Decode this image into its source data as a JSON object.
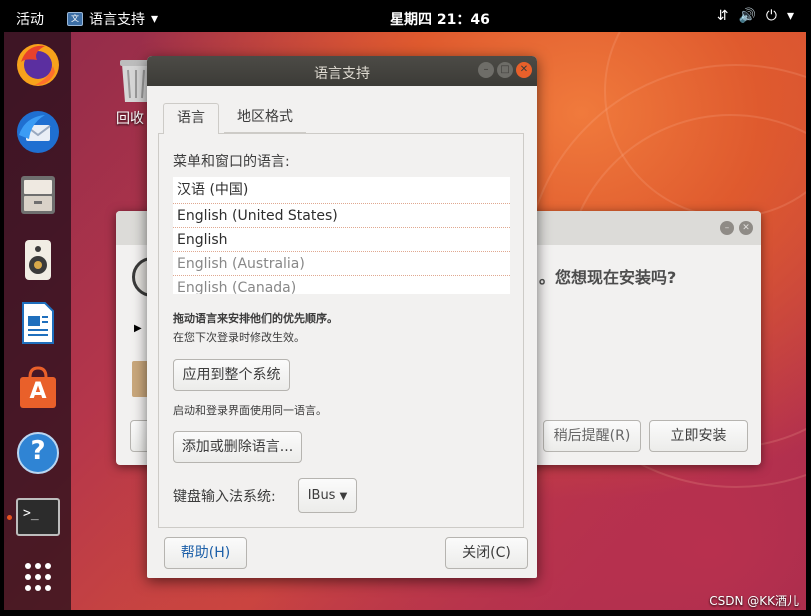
{
  "topbar": {
    "activities": "活动",
    "app_menu": "语言支持",
    "app_menu_arrow": "▾",
    "clock": "星期四 21：46",
    "tray_network": "⇵",
    "tray_volume": "🔊",
    "tray_power": "⏻",
    "tray_arrow": "▾"
  },
  "dock": {
    "items": [
      "firefox-icon",
      "thunderbird-icon",
      "files-icon",
      "rhythmbox-icon",
      "writer-icon",
      "software-icon",
      "help-icon",
      "terminal-icon"
    ],
    "help_glyph": "?",
    "software_glyph": "A",
    "terminal_glyph": ">_"
  },
  "desktop": {
    "trash_label": "回收"
  },
  "bg_dialog": {
    "question": "。您想现在安装吗?",
    "remind_later": "稍后提醒(R)",
    "install_now": "立即安装"
  },
  "dialog": {
    "title": "语言支持",
    "tabs": [
      "语言",
      "地区格式"
    ],
    "menu_lang_label": "菜单和窗口的语言:",
    "languages": [
      "汉语 (中国)",
      "English (United States)",
      "English",
      "English (Australia)",
      "English (Canada)"
    ],
    "drag_hint": "拖动语言来安排他们的优先顺序。",
    "next_login_hint": "在您下次登录时修改生效。",
    "apply_system_button": "应用到整个系统",
    "login_screen_hint": "启动和登录界面使用同一语言。",
    "add_remove_button": "添加或删除语言...",
    "input_method_label": "键盘输入法系统:",
    "input_method_value": "IBus",
    "help_button": "帮助(H)",
    "close_button": "关闭(C)"
  },
  "watermark": "CSDN @KK酒儿",
  "colors": {
    "accent": "#e95420",
    "titlebar": "#3c3b37",
    "close": "#e9602a",
    "dialog_bg": "#f2f1f0"
  }
}
